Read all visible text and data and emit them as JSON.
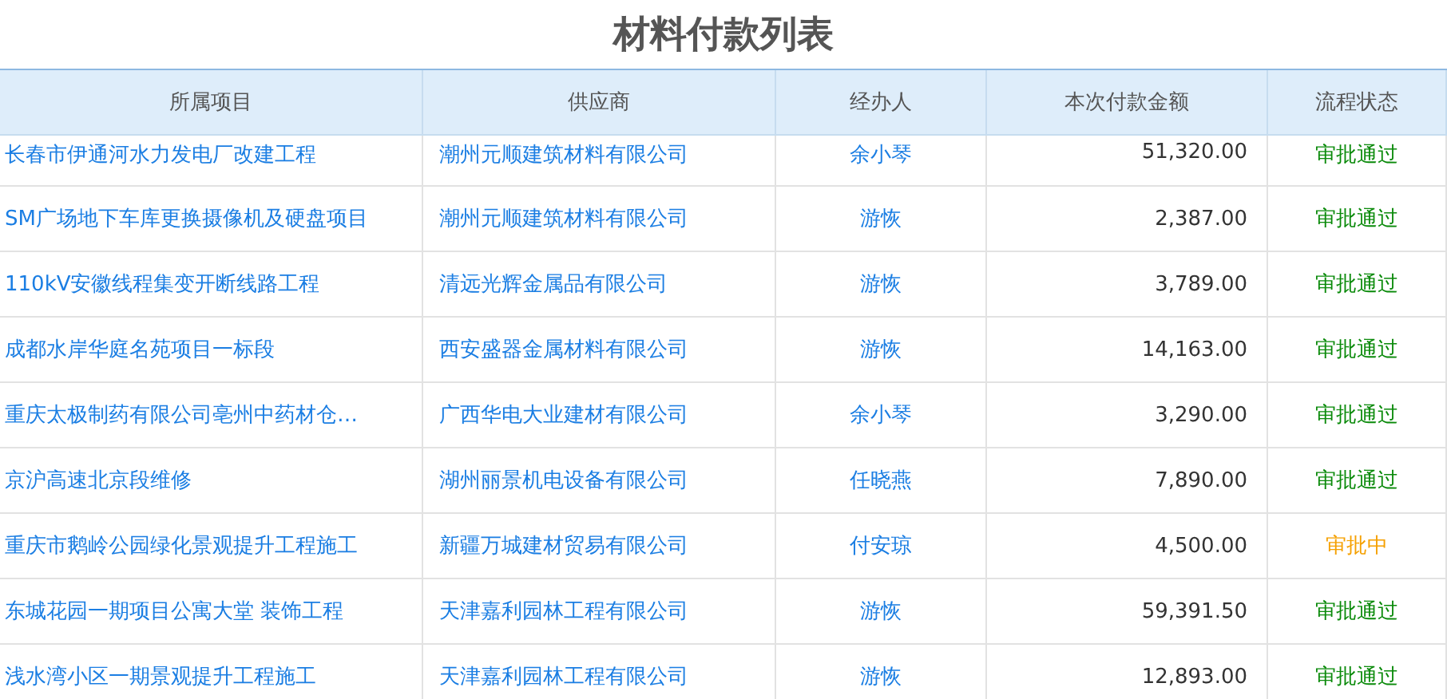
{
  "title": "材料付款列表",
  "table": {
    "columns": [
      "所属项目",
      "供应商",
      "经办人",
      "本次付款金额",
      "流程状态"
    ],
    "rows": [
      {
        "project": "长春市伊通河水力发电厂改建工程",
        "supplier": "潮州元顺建筑材料有限公司",
        "handler": "余小琴",
        "amount": "51,320.00",
        "status": {
          "text": "审批通过",
          "kind": "approved"
        }
      },
      {
        "project": "SM广场地下车库更换摄像机及硬盘项目",
        "supplier": "潮州元顺建筑材料有限公司",
        "handler": "游恢",
        "amount": "2,387.00",
        "status": {
          "text": "审批通过",
          "kind": "approved"
        }
      },
      {
        "project": "110kV安徽线程集变开断线路工程",
        "supplier": "清远光辉金属品有限公司",
        "handler": "游恢",
        "amount": "3,789.00",
        "status": {
          "text": "审批通过",
          "kind": "approved"
        }
      },
      {
        "project": "成都水岸华庭名苑项目一标段",
        "supplier": "西安盛器金属材料有限公司",
        "handler": "游恢",
        "amount": "14,163.00",
        "status": {
          "text": "审批通过",
          "kind": "approved"
        }
      },
      {
        "project": "重庆太极制药有限公司亳州中药材仓…",
        "supplier": "广西华电大业建材有限公司",
        "handler": "余小琴",
        "amount": "3,290.00",
        "status": {
          "text": "审批通过",
          "kind": "approved"
        }
      },
      {
        "project": "京沪高速北京段维修",
        "supplier": "湖州丽景机电设备有限公司",
        "handler": "任晓燕",
        "amount": "7,890.00",
        "status": {
          "text": "审批通过",
          "kind": "approved"
        }
      },
      {
        "project": "重庆市鹅岭公园绿化景观提升工程施工",
        "supplier": "新疆万城建材贸易有限公司",
        "handler": "付安琼",
        "amount": "4,500.00",
        "status": {
          "text": "审批中",
          "kind": "pending"
        }
      },
      {
        "project": "东城花园一期项目公寓大堂 装饰工程",
        "supplier": "天津嘉利园林工程有限公司",
        "handler": "游恢",
        "amount": "59,391.50",
        "status": {
          "text": "审批通过",
          "kind": "approved"
        }
      },
      {
        "project": "浅水湾小区一期景观提升工程施工",
        "supplier": "天津嘉利园林工程有限公司",
        "handler": "游恢",
        "amount": "12,893.00",
        "status": {
          "text": "审批通过",
          "kind": "approved"
        }
      }
    ]
  }
}
